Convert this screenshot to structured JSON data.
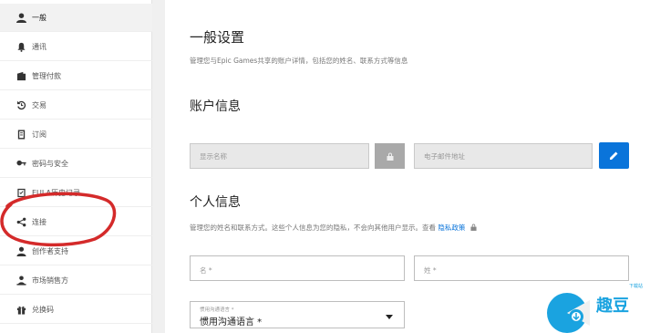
{
  "sidebar": {
    "items": [
      {
        "label": "一般",
        "icon": "person-icon",
        "active": true
      },
      {
        "label": "通讯",
        "icon": "bell-icon"
      },
      {
        "label": "管理付款",
        "icon": "wallet-icon"
      },
      {
        "label": "交易",
        "icon": "history-icon"
      },
      {
        "label": "订阅",
        "icon": "document-icon"
      },
      {
        "label": "密码与安全",
        "icon": "key-icon"
      },
      {
        "label": "EULA历史记录",
        "icon": "checklist-icon"
      },
      {
        "label": "连接",
        "icon": "share-icon"
      },
      {
        "label": "创作者支持",
        "icon": "creator-icon"
      },
      {
        "label": "市场销售方",
        "icon": "seller-icon"
      },
      {
        "label": "兑换码",
        "icon": "gift-icon"
      }
    ]
  },
  "main": {
    "title": "一般设置",
    "subtitle": "管理您与Epic Games共享的账户详情，包括您的姓名、联系方式等信息",
    "account": {
      "heading": "账户信息",
      "display_name_placeholder": "显示名称",
      "email_placeholder": "电子邮件地址"
    },
    "personal": {
      "heading": "个人信息",
      "description": "管理您的姓名和联系方式。这些个人信息为您的隐私，不会向其他用户显示。查看",
      "privacy_link": "隐私政策",
      "first_name_placeholder": "名 *",
      "last_name_placeholder": "姓 *",
      "language_label": "惯用沟通语言 *",
      "language_value": "惯用沟通语言 *"
    }
  },
  "colors": {
    "accent": "#0a74da",
    "annotation": "#d42a2a"
  },
  "watermark": {
    "text": "趣豆",
    "small_text": "下载站"
  }
}
